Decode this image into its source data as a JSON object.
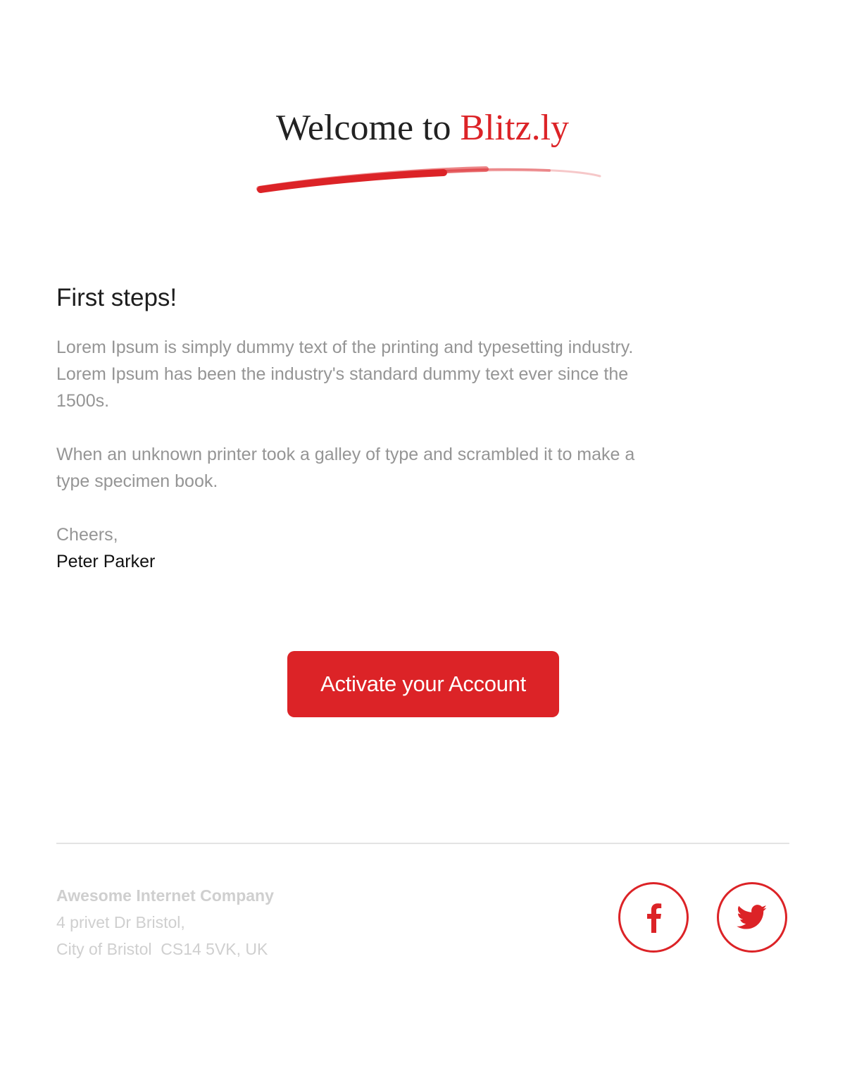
{
  "header": {
    "title_prefix": "Welcome to ",
    "title_brand": "Blitz.ly"
  },
  "content": {
    "heading": "First steps!",
    "paragraphs": [
      "Lorem Ipsum is simply dummy text of the printing and typesetting industry. Lorem Ipsum has been the industry's standard dummy text ever since the 1500s.",
      "When an unknown printer took a galley of type and scrambled it to make a type specimen book."
    ],
    "greeting": "Cheers,",
    "signer": "Peter Parker"
  },
  "cta": {
    "label": "Activate your Account"
  },
  "footer": {
    "company": "Awesome Internet Company",
    "address_line1": "4 privet Dr Bristol,",
    "address_line2": "City of Bristol  CS14 5VK, UK"
  },
  "social": [
    {
      "icon": "facebook-icon"
    },
    {
      "icon": "twitter-icon"
    }
  ],
  "colors": {
    "accent": "#dc2327",
    "body_text": "#959595",
    "footer_text": "#cfcfcf"
  }
}
